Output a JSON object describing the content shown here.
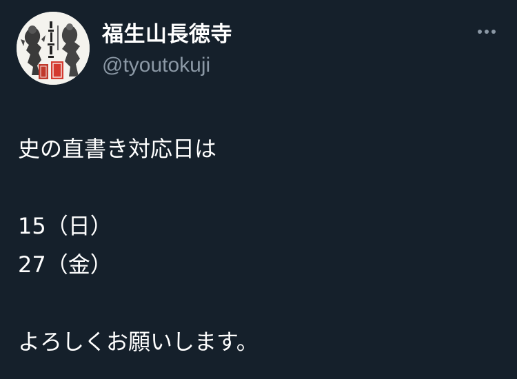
{
  "author": {
    "display_name": "福生山長徳寺",
    "handle": "@tyoutokuji"
  },
  "icons": {
    "avatar": "temple-stamp-avatar",
    "more": "more-options-icon"
  },
  "tweet": {
    "lines": [
      "史の直書き対応日は",
      "",
      "15（日）",
      "27（金）",
      "",
      "よろしくお願いします。"
    ]
  },
  "colors": {
    "background": "#15202b",
    "text": "#ffffff",
    "secondary_text": "#8b98a5"
  }
}
